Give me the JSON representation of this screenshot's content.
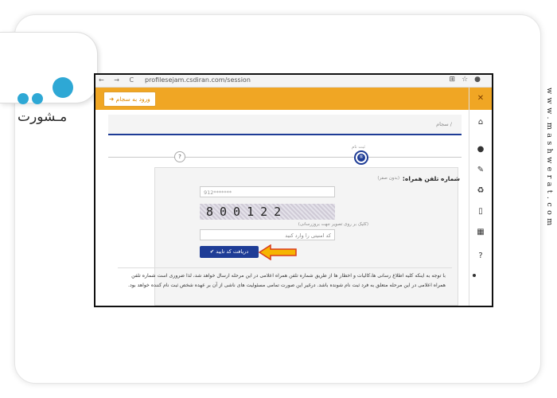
{
  "brand": {
    "logo_text": "مـشورت",
    "side_url": "www.mashwerat.com"
  },
  "browser": {
    "url": "profilesejam.csdiran.com/session",
    "nav": "← → C"
  },
  "header": {
    "login_button": "ورود به سجام"
  },
  "breadcrumb": "سجام /",
  "steps": {
    "active_label": "ثبت نام",
    "active_symbol": "®",
    "pending_symbol": "?"
  },
  "form": {
    "phone_label": "شماره تلفن همراه:",
    "phone_hint": "(بدون صفر)",
    "phone_value": "912*******",
    "captcha_text": "800122",
    "captcha_hint": "(کلیک بر روی تصویر جهت بروزرسانی)",
    "code_placeholder": "کد امنیتی را وارد کنید",
    "submit_label": "✔ دریافت کد تایید"
  },
  "note": "با توجه به اینکه کلیه اطلاع رسانی ها،کالیات و اخطار ها از طریق شماره تلفن همراه اعلامی در این مرحله ارسال خواهد شد، لذا ضروری است شماره تلفن همراه اعلامی در این مرحله متعلق به فرد ثبت نام شونده باشد. درغیر این صورت تمامی مسئولیت های ناشی از آن بر عهده شخص ثبت نام کننده خواهد بود.",
  "sidebar_icons": [
    "home-icon",
    "user-icon",
    "edit-icon",
    "recycle-icon",
    "mobile-icon",
    "document-icon",
    "help-icon"
  ],
  "colors": {
    "accent": "#f0a624",
    "primary": "#1e3c96",
    "arrow": "#f6b400"
  }
}
